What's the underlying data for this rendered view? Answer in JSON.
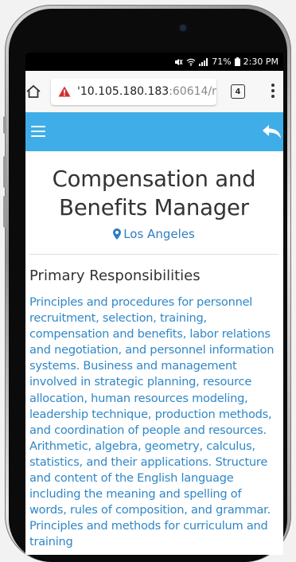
{
  "status_bar": {
    "icons": [
      "mute-icon",
      "wifi-icon",
      "signal-icon",
      "battery-icon"
    ],
    "battery": "71%",
    "time": "2:30 PM"
  },
  "browser": {
    "url_host": "'10.105.180.183",
    "url_rest": ":60614/r",
    "tab_count": "4"
  },
  "job": {
    "title": "Compensation and Benefits Manager",
    "location": "Los Angeles"
  },
  "section": {
    "heading": "Primary Responsibilities",
    "text": "Principles and procedures for personnel recruitment, selection, training, compensation and benefits, labor relations and negotiation, and personnel information systems. Business and management involved in strategic planning, resource allocation, human resources modeling, leadership technique, production methods, and coordination of people and resources. Arithmetic, algebra, geometry, calculus, statistics, and their applications. Structure and content of the English language including the meaning and spelling of words, rules of composition, and grammar. Principles and methods for curriculum and training"
  },
  "colors": {
    "app_bar": "#3faee8",
    "link_text": "#2f87c8",
    "warning": "#d32f2f"
  }
}
